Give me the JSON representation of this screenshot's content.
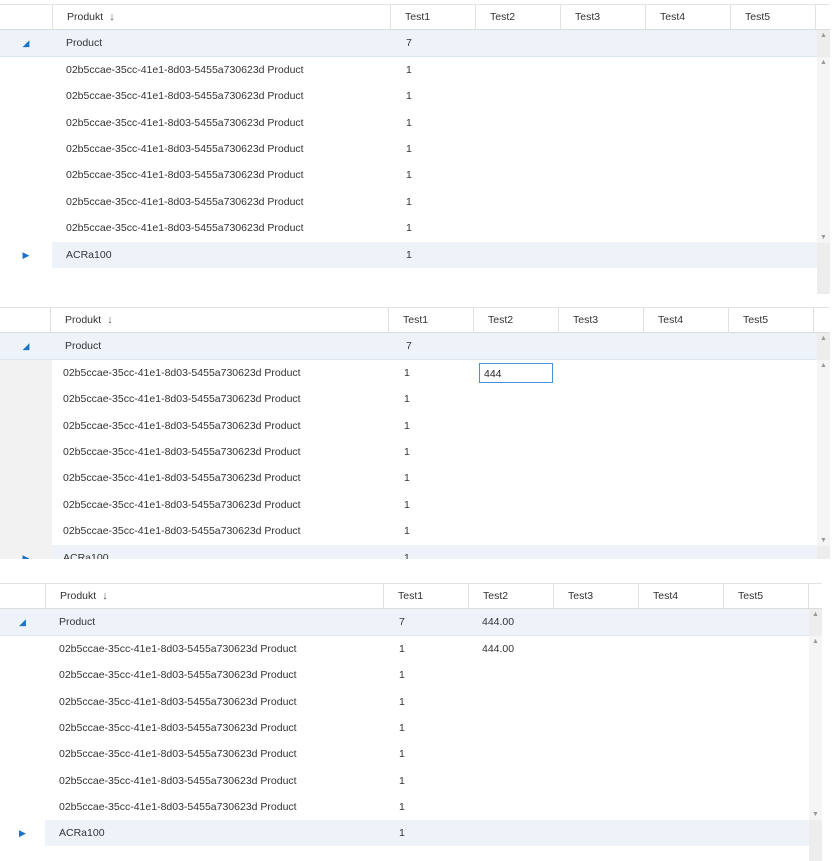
{
  "columns": [
    "Produkt",
    "Test1",
    "Test2",
    "Test3",
    "Test4",
    "Test5"
  ],
  "sort_icon": "arrow-down-icon",
  "group_label": "Product",
  "group_count": "7",
  "product_name": "02b5ccae-35cc-41e1-8d03-5455a730623d Product",
  "leaf_value": "1",
  "second_group": "ACRa100",
  "second_group_value": "1",
  "edit_value": "444",
  "saved_value": "444.00",
  "colors": {
    "group_bg": "#eef3fa",
    "expander": "#1a73c8",
    "edit_border": "#4a90d9"
  }
}
